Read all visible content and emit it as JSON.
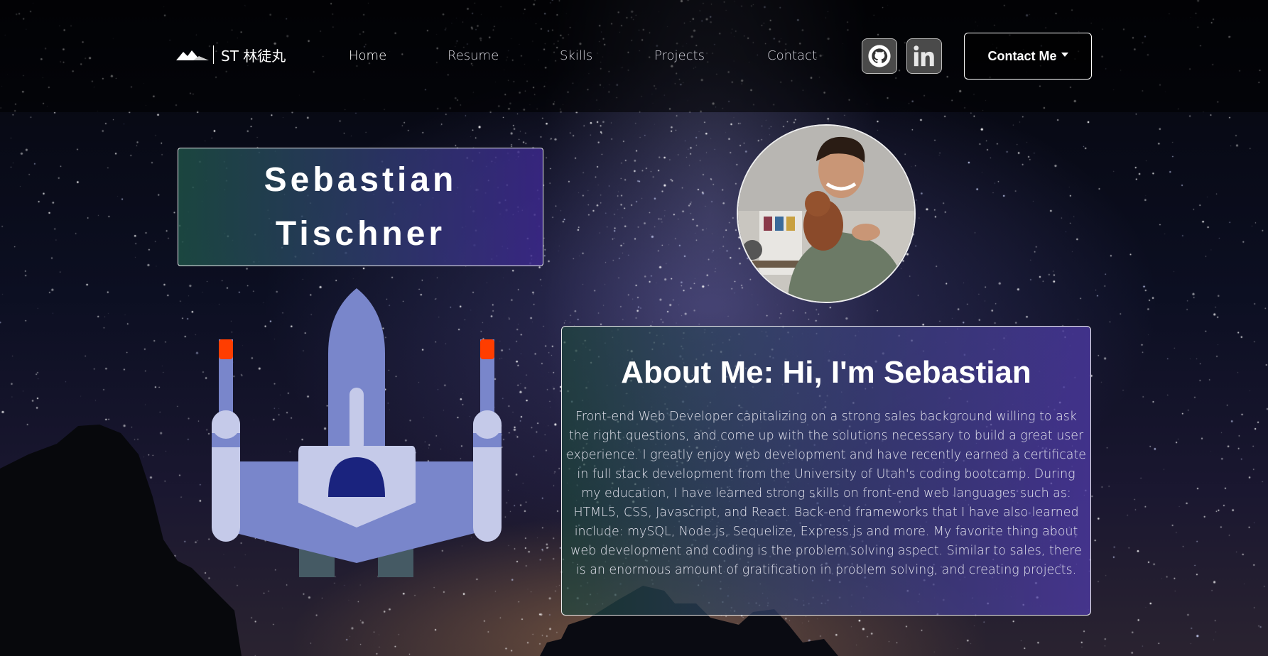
{
  "header": {
    "logo_text": "ST 林徒丸",
    "nav": [
      {
        "label": "Home"
      },
      {
        "label": "Resume"
      },
      {
        "label": "Skills"
      },
      {
        "label": "Projects"
      },
      {
        "label": "Contact"
      }
    ],
    "social": [
      {
        "icon": "github-icon"
      },
      {
        "icon": "linkedin-icon"
      }
    ],
    "contact_button": "Contact Me"
  },
  "hero": {
    "name_line1": "Sebastian",
    "name_line2": "Tischner",
    "photo_alt": "Profile photo"
  },
  "about": {
    "title": "About Me: Hi, I'm Sebastian",
    "body": "Front-end Web Developer capitalizing on a strong sales background willing to ask the right questions, and come up with the solutions necessary to build a great user experience. I greatly enjoy web development and have recently earned a certificate in full stack development from the University of Utah's coding bootcamp. During my education, I have learned strong skills on front-end web languages such as: HTML5, CSS, Javascript, and React. Back-end frameworks that I have also learned include: mySQL, Node.js, Sequelize, Express.js and more. My favorite thing about web development and coding is the problem solving aspect. Similar to sales, there is an enormous amount of gratification in problem solving, and creating projects."
  },
  "colors": {
    "ship_body": "#7986cb",
    "ship_light": "#c5cae9",
    "ship_dome": "#1a237e",
    "ship_flame": "#ff3d00",
    "ship_engine": "#455a64"
  }
}
